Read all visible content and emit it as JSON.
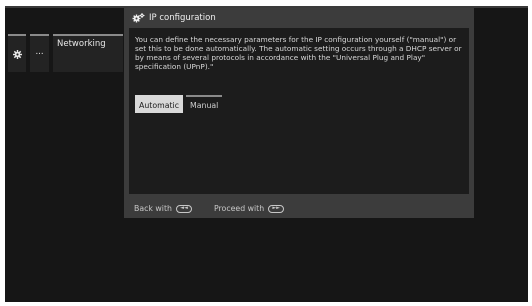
{
  "breadcrumb": {
    "gear_icon": "gear-icon",
    "dots_label": "...",
    "networking_label": "Networking"
  },
  "dialog": {
    "icon": "gear-icon",
    "title": "IP configuration",
    "description": "You can define the necessary parameters for the IP configuration yourself (\"manual\") or set this to be done automatically. The automatic setting occurs through a DHCP server or by means of several protocols in accordance with the \"Universal Plug and Play\" specification (UPnP).\"",
    "tabs": [
      {
        "label": "Automatic",
        "selected": true
      },
      {
        "label": "Manual",
        "selected": false
      }
    ],
    "footer": {
      "back_label": "Back with",
      "back_button_glyph": "◄◄",
      "proceed_label": "Proceed with",
      "proceed_button_glyph": "►►"
    }
  },
  "colors": {
    "screen_bg": "#161616",
    "dialog_bg": "#3c3c3c",
    "body_bg": "#1c1c1c",
    "tab_active_bg": "#d9d9d9",
    "accent_line": "#8a8a8a"
  }
}
